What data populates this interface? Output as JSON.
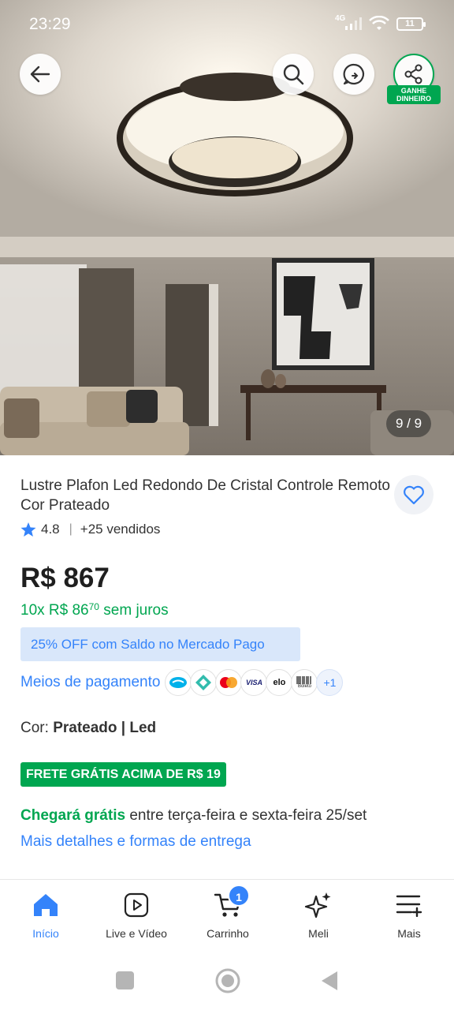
{
  "status_bar": {
    "time": "23:29",
    "network": "4G",
    "battery": "11"
  },
  "gallery": {
    "counter": "9 / 9",
    "reward_label_line1": "GANHE",
    "reward_label_line2": "DINHEIRO"
  },
  "product": {
    "title": "Lustre Plafon Led Redondo De Cristal Controle Remoto Cor Prateado",
    "rating": "4.8",
    "sold": "+25 vendidos",
    "price": "R$ 867",
    "installments_prefix": "10x R$ 86",
    "installments_cents": "70",
    "installments_suffix": "sem juros",
    "promo": "25% OFF com Saldo no Mercado Pago",
    "payment_methods_label": "Meios de pagamento",
    "payment_icons": [
      "mercado-pago-icon",
      "pix-icon",
      "mastercard-icon",
      "visa-icon",
      "elo-icon",
      "boleto-icon"
    ],
    "payment_visa_text": "VISA",
    "payment_elo_text": "elo",
    "payment_boleto_text": "Boleto",
    "payment_more": "+1",
    "color_label": "Cor:",
    "color_value": "Prateado | Led",
    "free_shipping_badge": "FRETE GRÁTIS ACIMA DE R$ 19",
    "shipping_highlight": "Chegará grátis",
    "shipping_text": "entre terça-feira e sexta-feira 25/set",
    "shipping_details_link": "Mais detalhes e formas de entrega"
  },
  "tabbar": {
    "items": [
      {
        "label": "Início",
        "icon": "home-icon",
        "active": true
      },
      {
        "label": "Live e Vídeo",
        "icon": "play-icon",
        "active": false
      },
      {
        "label": "Carrinho",
        "icon": "cart-icon",
        "active": false,
        "badge": "1"
      },
      {
        "label": "Meli",
        "icon": "sparkle-icon",
        "active": false
      },
      {
        "label": "Mais",
        "icon": "menu-plus-icon",
        "active": false
      }
    ]
  },
  "colors": {
    "accent": "#3483fa",
    "green": "#00a650",
    "promo_bg": "#d9e7fa"
  }
}
